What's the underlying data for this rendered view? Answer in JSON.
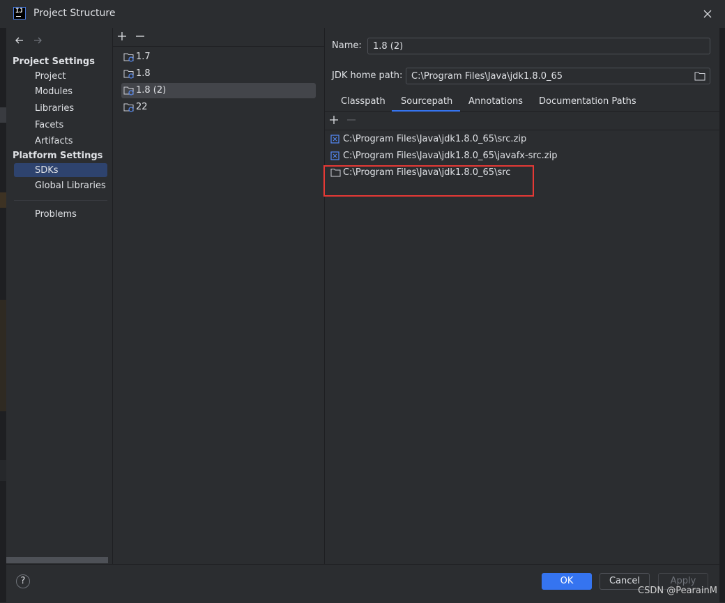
{
  "window": {
    "title": "Project Structure"
  },
  "nav": {
    "project_settings_header": "Project Settings",
    "project_items": [
      "Project",
      "Modules",
      "Libraries",
      "Facets",
      "Artifacts"
    ],
    "platform_settings_header": "Platform Settings",
    "platform_items": [
      "SDKs",
      "Global Libraries"
    ],
    "selected": "SDKs",
    "problems": "Problems"
  },
  "sdks": {
    "items": [
      "1.7",
      "1.8",
      "1.8 (2)",
      "22"
    ],
    "selected": "1.8 (2)"
  },
  "detail": {
    "name_label": "Name:",
    "name_value": "1.8 (2)",
    "home_label": "JDK home path:",
    "home_value": "C:\\Program Files\\Java\\jdk1.8.0_65",
    "tabs": [
      "Classpath",
      "Sourcepath",
      "Annotations",
      "Documentation Paths"
    ],
    "active_tab": "Sourcepath",
    "paths": [
      {
        "icon": "archive-icon",
        "label": "C:\\Program Files\\Java\\jdk1.8.0_65\\src.zip"
      },
      {
        "icon": "archive-icon",
        "label": "C:\\Program Files\\Java\\jdk1.8.0_65\\javafx-src.zip"
      },
      {
        "icon": "folder-icon",
        "label": "C:\\Program Files\\Java\\jdk1.8.0_65\\src"
      }
    ]
  },
  "footer": {
    "help": "?",
    "ok": "OK",
    "cancel": "Cancel",
    "apply": "Apply"
  },
  "watermark": "CSDN @PearainM",
  "colors": {
    "accent": "#3574f0",
    "highlight_box": "#e53935",
    "background": "#2b2d30"
  }
}
